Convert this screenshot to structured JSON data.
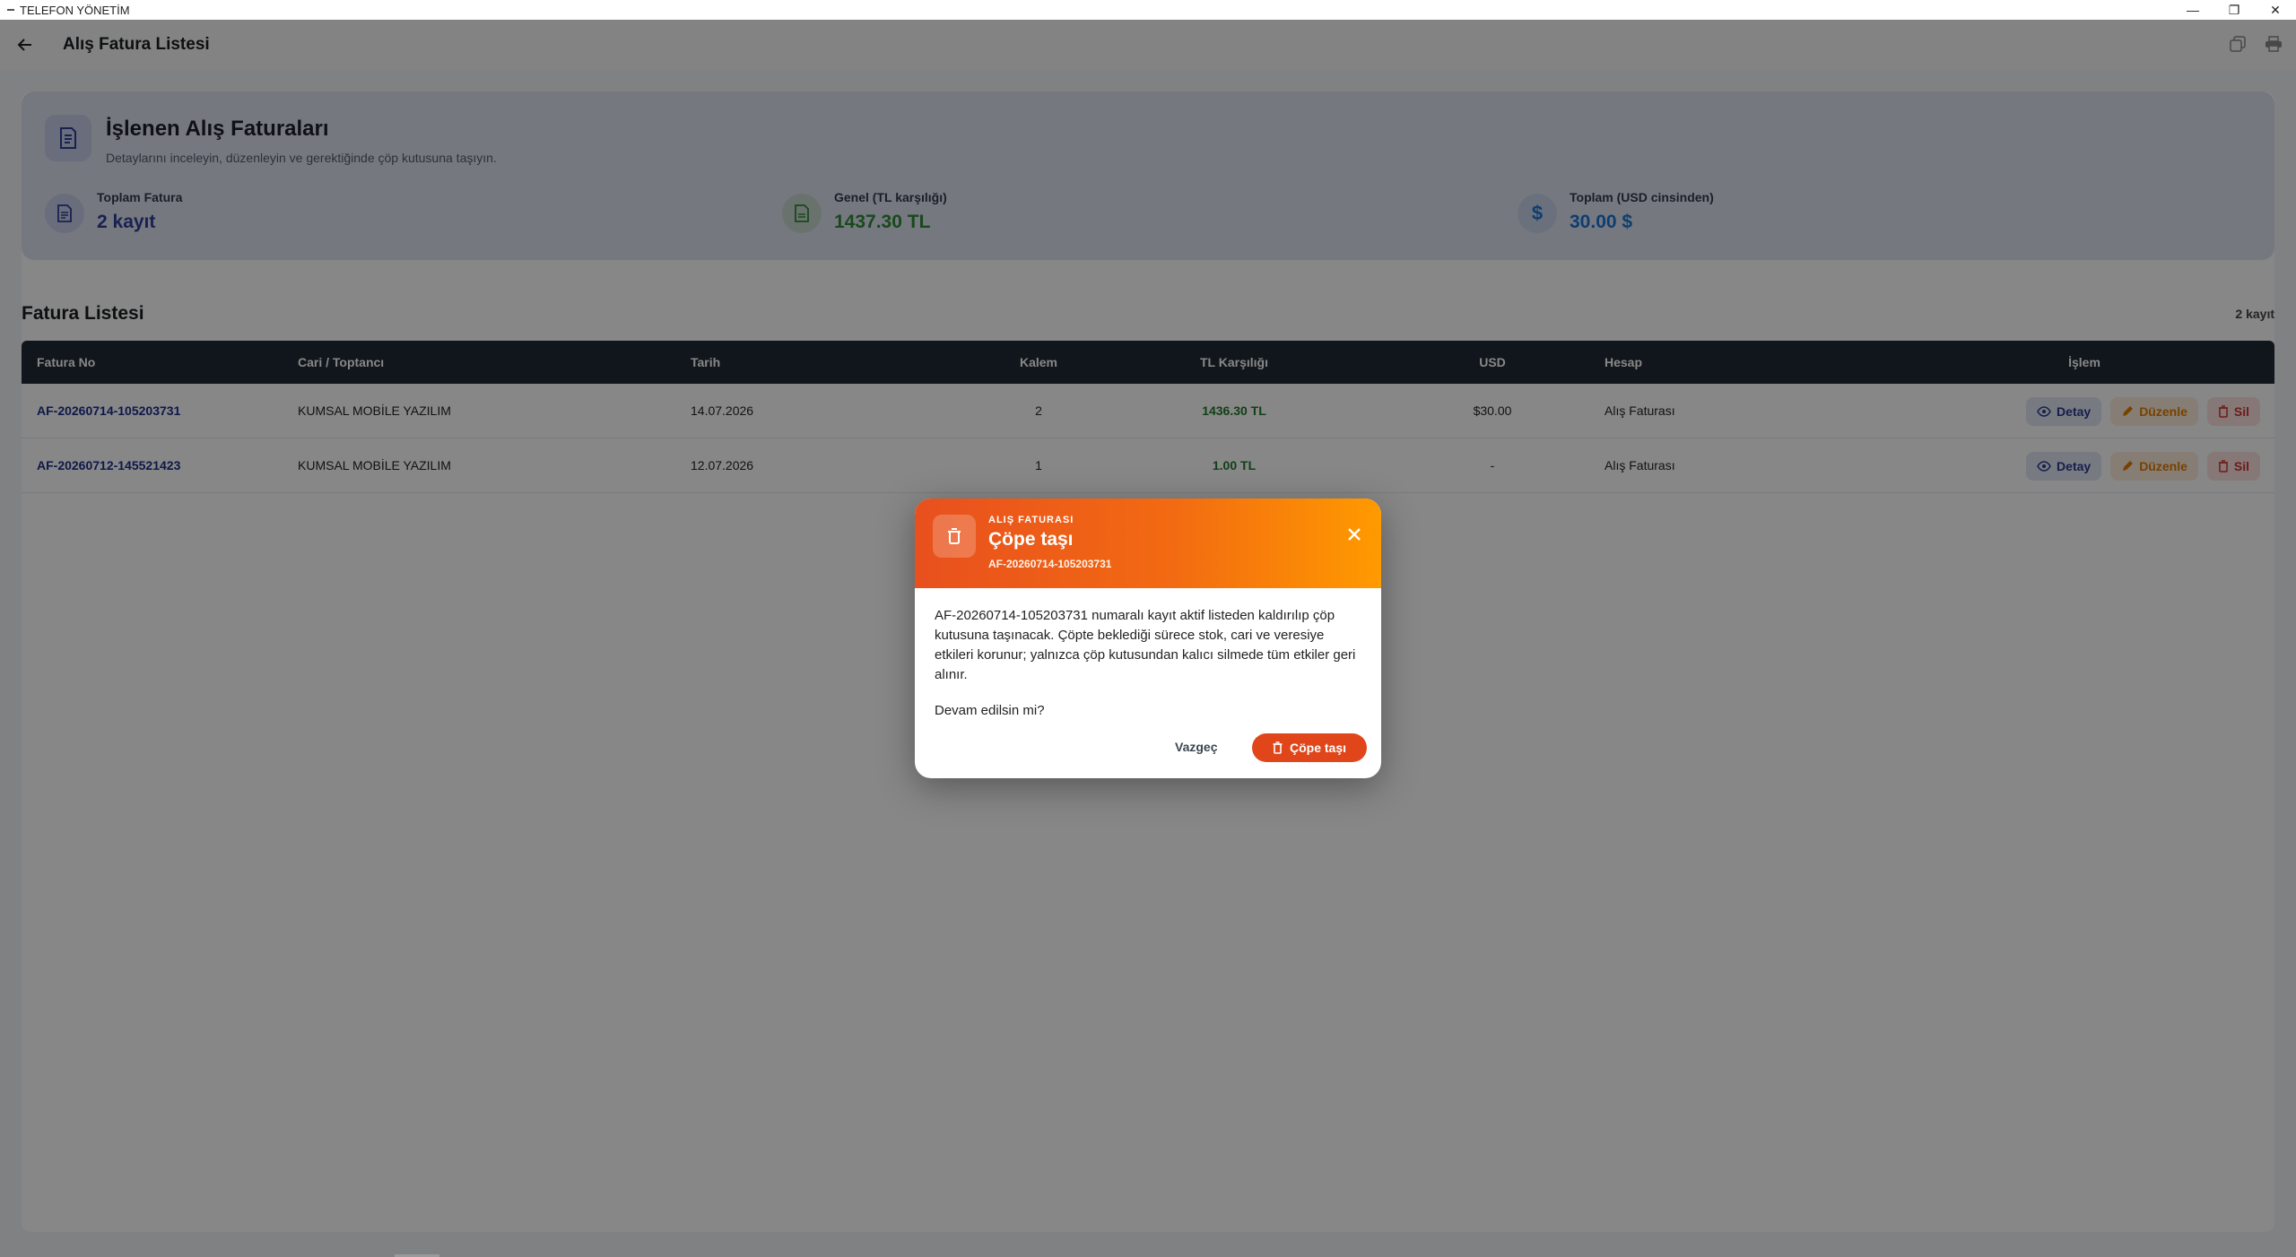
{
  "window": {
    "title": "TELEFON YÖNETİM",
    "minimize": "—",
    "restore": "❐",
    "close": "✕"
  },
  "appbar": {
    "title": "Alış Fatura Listesi",
    "copy_icon": "copy-icon",
    "print_icon": "print-icon"
  },
  "summary": {
    "title": "İşlenen Alış Faturaları",
    "subtitle": "Detaylarını inceleyin, düzenleyin ve gerektiğinde çöp kutusuna taşıyın.",
    "stats": [
      {
        "label": "Toplam Fatura",
        "value": "2 kayıt",
        "color": "#2f3f9a",
        "icon": "document-icon"
      },
      {
        "label": "Genel (TL karşılığı)",
        "value": "1437.30 TL",
        "color": "#2e8a36",
        "icon": "receipt-icon"
      },
      {
        "label": "Toplam (USD cinsinden)",
        "value": "30.00 $",
        "color": "#1976d2",
        "icon": "dollar-icon"
      }
    ]
  },
  "list": {
    "title": "Fatura Listesi",
    "count": "2 kayıt",
    "columns": [
      "Fatura No",
      "Cari / Toptancı",
      "Tarih",
      "Kalem",
      "TL Karşılığı",
      "USD",
      "Hesap",
      "İşlem"
    ],
    "rows": [
      {
        "no": "AF-20260714-105203731",
        "cari": "KUMSAL MOBİLE YAZILIM",
        "tarih": "14.07.2026",
        "kalem": "2",
        "tl": "1436.30 TL",
        "usd": "$30.00",
        "hesap": "Alış Faturası"
      },
      {
        "no": "AF-20260712-145521423",
        "cari": "KUMSAL MOBİLE YAZILIM",
        "tarih": "12.07.2026",
        "kalem": "1",
        "tl": "1.00 TL",
        "usd": "-",
        "hesap": "Alış Faturası"
      }
    ],
    "actions": {
      "detail": "Detay",
      "edit": "Düzenle",
      "delete": "Sil"
    }
  },
  "dialog": {
    "kicker": "ALIŞ FATURASI",
    "title": "Çöpe taşı",
    "subtitle": "AF-20260714-105203731",
    "body": "AF-20260714-105203731 numaralı kayıt aktif listeden kaldırılıp çöp kutusuna taşınacak. Çöpte beklediği sürece stok, cari ve veresiye etkileri korunur; yalnızca çöp kutusundan kalıcı silmede tüm etkiler geri alınır.",
    "question": "Devam edilsin mi?",
    "cancel": "Vazgeç",
    "confirm": "Çöpe taşı",
    "accent": "#e1461b"
  }
}
